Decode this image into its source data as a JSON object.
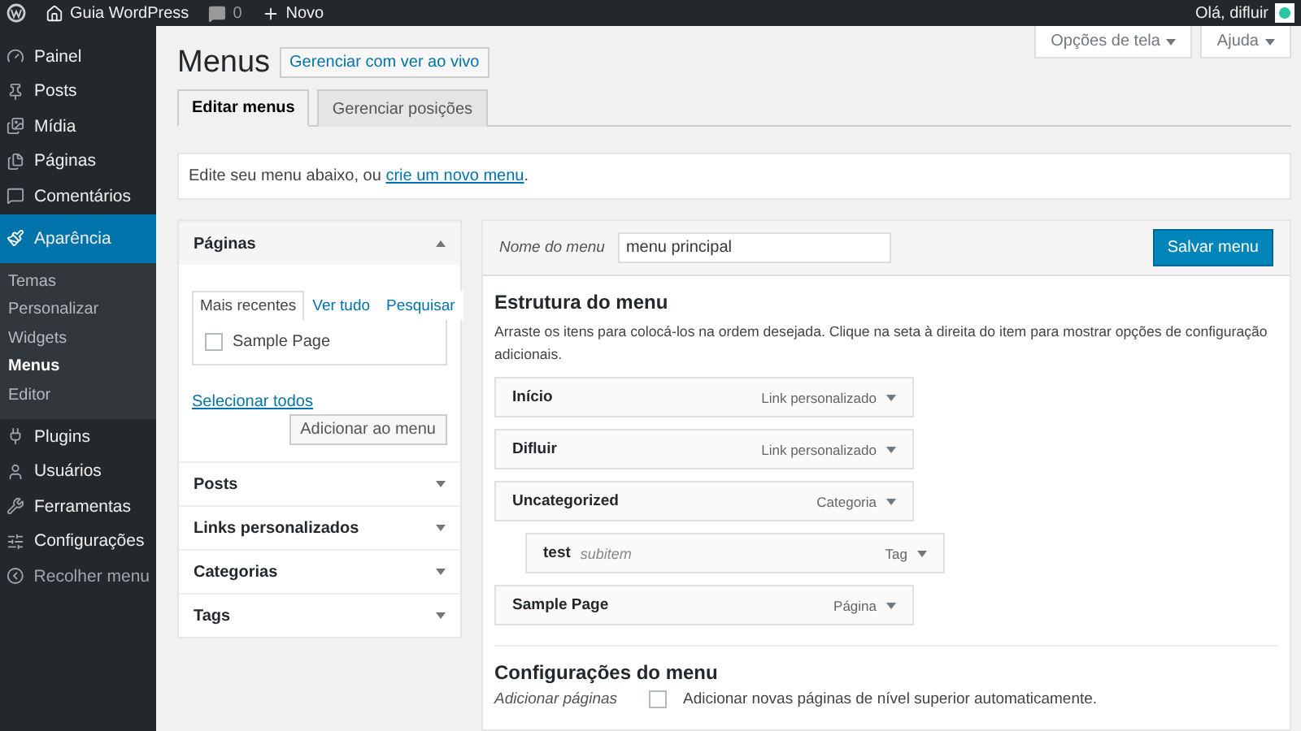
{
  "admin_bar": {
    "site": "Guia WordPress",
    "comments": "0",
    "new": "Novo",
    "greeting": "Olá, difluir"
  },
  "sidebar": {
    "items": [
      {
        "label": "Painel",
        "selected": false
      },
      {
        "label": "Posts",
        "selected": false
      },
      {
        "label": "Mídia",
        "selected": false
      },
      {
        "label": "Páginas",
        "selected": false
      },
      {
        "label": "Comentários",
        "selected": false
      },
      {
        "label": "Aparência",
        "selected": true,
        "children": [
          {
            "label": "Temas",
            "selected": false
          },
          {
            "label": "Personalizar",
            "selected": false
          },
          {
            "label": "Widgets",
            "selected": false
          },
          {
            "label": "Menus",
            "selected": true
          },
          {
            "label": "Editor",
            "selected": false
          }
        ]
      },
      {
        "label": "Plugins",
        "selected": false
      },
      {
        "label": "Usuários",
        "selected": false
      },
      {
        "label": "Ferramentas",
        "selected": false
      },
      {
        "label": "Configurações",
        "selected": false
      }
    ],
    "collapse": "Recolher menu"
  },
  "header": {
    "title": "Menus",
    "live_button": "Gerenciar com ver ao vivo",
    "screen_options": "Opções de tela",
    "help": "Ajuda"
  },
  "tabs": [
    {
      "label": "Editar menus",
      "selected": true
    },
    {
      "label": "Gerenciar posições",
      "selected": false
    }
  ],
  "notice": {
    "text": "Edite seu menu abaixo, ou",
    "link": "crie um novo menu",
    "end": "."
  },
  "accordion": [
    {
      "title": "Páginas",
      "expanded": true,
      "subtabs": [
        {
          "label": "Mais recentes",
          "selected": true
        },
        {
          "label": "Ver tudo",
          "selected": false
        },
        {
          "label": "Pesquisar",
          "selected": false
        }
      ],
      "items": [
        {
          "label": "Sample Page",
          "checked": false
        }
      ],
      "select_all": "Selecionar todos",
      "add_button": "Adicionar ao menu"
    },
    {
      "title": "Posts",
      "expanded": false
    },
    {
      "title": "Links personalizados",
      "expanded": false
    },
    {
      "title": "Categorias",
      "expanded": false
    },
    {
      "title": "Tags",
      "expanded": false
    }
  ],
  "editor": {
    "name_label": "Nome do menu",
    "name_value": "menu principal",
    "save_button": "Salvar menu",
    "structure_title": "Estrutura do menu",
    "instructions": "Arraste os itens para colocá-los na ordem desejada. Clique na seta à direita do item para mostrar opções de configuração adicionais.",
    "items": [
      {
        "title": "Início",
        "type": "Link personalizado"
      },
      {
        "title": "Difluir",
        "type": "Link personalizado"
      },
      {
        "title": "Uncategorized",
        "type": "Categoria",
        "children": [
          {
            "title": "test",
            "note": "subitem",
            "type": "Tag"
          }
        ]
      },
      {
        "title": "Sample Page",
        "type": "Página"
      }
    ],
    "settings_title": "Configurações do menu",
    "auto_add_label": "Adicionar páginas",
    "auto_add_text": "Adicionar novas páginas de nível superior automaticamente.",
    "auto_add_checked": false
  }
}
